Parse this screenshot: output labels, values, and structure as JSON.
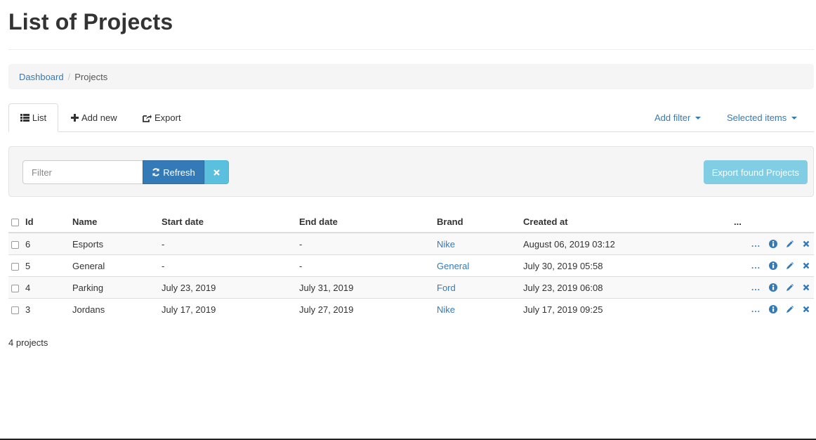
{
  "page": {
    "title": "List of Projects"
  },
  "breadcrumb": {
    "home": "Dashboard",
    "separator": "/",
    "current": "Projects"
  },
  "tabs": {
    "list": "List",
    "add_new": "Add new",
    "export": "Export",
    "add_filter": "Add filter",
    "selected_items": "Selected items"
  },
  "filter": {
    "placeholder": "Filter",
    "refresh_label": "Refresh",
    "export_found_label": "Export found Projects"
  },
  "table": {
    "headers": {
      "id": "Id",
      "name": "Name",
      "start_date": "Start date",
      "end_date": "End date",
      "brand": "Brand",
      "created_at": "Created at",
      "actions": "..."
    },
    "rows": [
      {
        "id": "6",
        "name": "Esports",
        "start_date": "-",
        "end_date": "-",
        "brand": "Nike",
        "created_at": "August 06, 2019 03:12",
        "more": "..."
      },
      {
        "id": "5",
        "name": "General",
        "start_date": "-",
        "end_date": "-",
        "brand": "General",
        "created_at": "July 30, 2019 05:58",
        "more": "..."
      },
      {
        "id": "4",
        "name": "Parking",
        "start_date": "July 23, 2019",
        "end_date": "July 31, 2019",
        "brand": "Ford",
        "created_at": "July 23, 2019 06:08",
        "more": "..."
      },
      {
        "id": "3",
        "name": "Jordans",
        "start_date": "July 17, 2019",
        "end_date": "July 27, 2019",
        "brand": "Nike",
        "created_at": "July 17, 2019 09:25",
        "more": "..."
      }
    ]
  },
  "footer": {
    "count": "4 projects"
  },
  "icons": {
    "list": "list-icon",
    "add": "plus-icon",
    "export": "share-icon",
    "refresh": "refresh-icon",
    "clear": "close-icon",
    "info": "info-icon",
    "edit": "pencil-icon",
    "delete": "close-icon"
  },
  "colors": {
    "link": "#337ab7",
    "primary": "#337ab7",
    "info": "#5bc0de"
  }
}
